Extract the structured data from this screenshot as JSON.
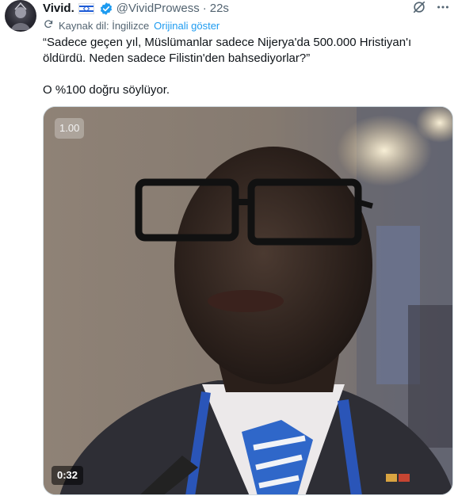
{
  "author": {
    "display_name": "Vivid.",
    "flag_icon": "israel-flag-icon",
    "verified_icon": "verified-badge-icon",
    "handle": "@VividProwess",
    "separator": "·",
    "time": "22s"
  },
  "header_icons": [
    "grok-icon",
    "more-options-icon"
  ],
  "translation": {
    "icon": "translate-icon",
    "label": "Kaynak dil: İngilizce",
    "action": "Orijinali göster"
  },
  "tweet": {
    "paragraphs": [
      "“Sadece geçen yıl, Müslümanlar sadece Nijerya'da 500.000 Hristiyan'ı öldürdü. Neden sadece Filistin'den bahsediyorlar?”",
      "O %100 doğru söylüyor."
    ]
  },
  "video": {
    "playback_speed": "1.00",
    "duration": "0:32"
  },
  "colors": {
    "text": "#0f1419",
    "secondary": "#536471",
    "link": "#1d9bf0",
    "verified": "#1d9bf0"
  }
}
